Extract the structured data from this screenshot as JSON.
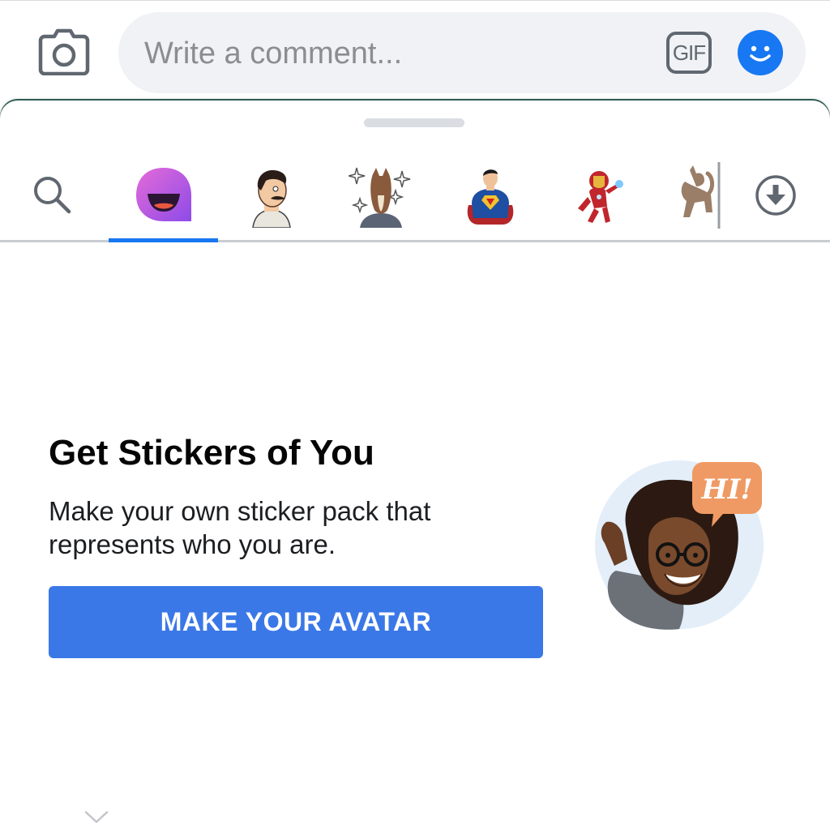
{
  "composer": {
    "placeholder": "Write a comment...",
    "gif_label": "GIF",
    "icons": {
      "camera": "camera-icon",
      "emoji": "emoji-smile-icon"
    }
  },
  "sticker_tabs": [
    {
      "id": "search",
      "icon": "search-icon"
    },
    {
      "id": "avatar",
      "icon": "avatar-sticker-pack-icon",
      "selected": true
    },
    {
      "id": "bobs-burgers",
      "icon": "mustache-man-sticker-icon"
    },
    {
      "id": "bojack",
      "icon": "horse-sticker-icon"
    },
    {
      "id": "superman",
      "icon": "superhero-sticker-icon"
    },
    {
      "id": "ironman",
      "icon": "ironman-sticker-icon"
    },
    {
      "id": "cat",
      "icon": "cat-sticker-icon"
    },
    {
      "id": "store",
      "icon": "download-icon"
    }
  ],
  "promo": {
    "title": "Get Stickers of You",
    "description": "Make your own sticker pack that represents who you are.",
    "button_label": "MAKE YOUR AVATAR",
    "speech_bubble": "HI!"
  },
  "colors": {
    "accent": "#1877f2",
    "button": "#3b78e7",
    "input_bg": "#f0f2f5",
    "divider": "#c9ccd1"
  }
}
